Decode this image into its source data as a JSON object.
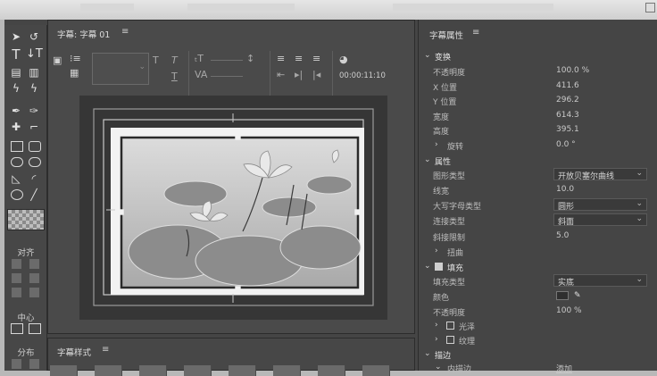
{
  "editor": {
    "title": "字幕: 字幕 01",
    "timecode": "00:00:11:10"
  },
  "tools": {
    "align_label": "对齐",
    "center_label": "中心",
    "distribute_label": "分布"
  },
  "style_panel": {
    "title": "字幕样式"
  },
  "properties": {
    "title": "字幕属性",
    "transform": {
      "label": "变换",
      "opacity_label": "不透明度",
      "opacity_value": "100.0 %",
      "x_label": "X 位置",
      "x_value": "411.6",
      "y_label": "Y 位置",
      "y_value": "296.2",
      "width_label": "宽度",
      "width_value": "614.3",
      "height_label": "高度",
      "height_value": "395.1",
      "rotation_label": "旋转",
      "rotation_value": "0.0 °"
    },
    "attributes": {
      "label": "属性",
      "graphic_type_label": "图形类型",
      "graphic_type_value": "开放贝塞尔曲线",
      "line_width_label": "线宽",
      "line_width_value": "10.0",
      "cap_type_label": "大写字母类型",
      "cap_type_value": "圆形",
      "join_type_label": "连接类型",
      "join_type_value": "斜面",
      "miter_limit_label": "斜接限制",
      "miter_limit_value": "5.0",
      "distort_label": "扭曲"
    },
    "fill": {
      "label": "填充",
      "fill_type_label": "填充类型",
      "fill_type_value": "实底",
      "color_label": "颜色",
      "color_value": "#2f2f2f",
      "opacity_label": "不透明度",
      "opacity_value": "100 %",
      "sheen_label": "光泽",
      "texture_label": "纹理"
    },
    "stroke": {
      "label": "描边",
      "inner_label": "内描边",
      "inner_action": "添加"
    }
  }
}
